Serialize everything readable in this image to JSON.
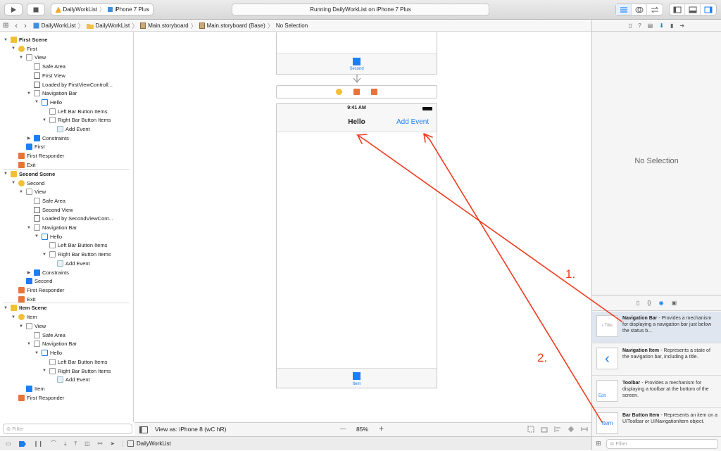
{
  "toolbar": {
    "scheme_name": "DailyWorkList",
    "device": "iPhone 7 Plus",
    "status_text": "Running DailyWorkList on iPhone 7 Plus"
  },
  "jumpbar": {
    "items": [
      "DailyWorkList",
      "DailyWorkList",
      "Main.storyboard",
      "Main.storyboard (Base)",
      "No Selection"
    ]
  },
  "outline": {
    "rows": [
      {
        "label": "First Scene",
        "level": 0,
        "kind": "scene",
        "tri": "▼"
      },
      {
        "label": "First",
        "level": 1,
        "kind": "vc",
        "tri": "▼"
      },
      {
        "label": "View",
        "level": 2,
        "kind": "view",
        "tri": "▼"
      },
      {
        "label": "Safe Area",
        "level": 3,
        "kind": "guide",
        "tri": ""
      },
      {
        "label": "First View",
        "level": 3,
        "kind": "label",
        "tri": ""
      },
      {
        "label": "Loaded by FirstViewControll...",
        "level": 3,
        "kind": "label",
        "tri": ""
      },
      {
        "label": "Navigation Bar",
        "level": 3,
        "kind": "view",
        "tri": "▼"
      },
      {
        "label": "Hello",
        "level": 4,
        "kind": "navitem",
        "tri": "▼"
      },
      {
        "label": "Left Bar Button Items",
        "level": 5,
        "kind": "view",
        "tri": ""
      },
      {
        "label": "Right Bar Button Items",
        "level": 5,
        "kind": "view",
        "tri": "▼"
      },
      {
        "label": "Add Event",
        "level": 6,
        "kind": "barbutton",
        "tri": ""
      },
      {
        "label": "Constraints",
        "level": 3,
        "kind": "constraints",
        "tri": "▶"
      },
      {
        "label": "First",
        "level": 2,
        "kind": "star",
        "tri": ""
      },
      {
        "label": "First Responder",
        "level": 1,
        "kind": "responder",
        "tri": ""
      },
      {
        "label": "Exit",
        "level": 1,
        "kind": "exit",
        "tri": ""
      },
      {
        "label": "Second Scene",
        "level": 0,
        "kind": "scene",
        "tri": "▼"
      },
      {
        "label": "Second",
        "level": 1,
        "kind": "vc",
        "tri": "▼"
      },
      {
        "label": "View",
        "level": 2,
        "kind": "view",
        "tri": "▼"
      },
      {
        "label": "Safe Area",
        "level": 3,
        "kind": "guide",
        "tri": ""
      },
      {
        "label": "Second View",
        "level": 3,
        "kind": "label",
        "tri": ""
      },
      {
        "label": "Loaded by SecondViewCont...",
        "level": 3,
        "kind": "label",
        "tri": ""
      },
      {
        "label": "Navigation Bar",
        "level": 3,
        "kind": "view",
        "tri": "▼"
      },
      {
        "label": "Hello",
        "level": 4,
        "kind": "navitem",
        "tri": "▼"
      },
      {
        "label": "Left Bar Button Items",
        "level": 5,
        "kind": "view",
        "tri": ""
      },
      {
        "label": "Right Bar Button Items",
        "level": 5,
        "kind": "view",
        "tri": "▼"
      },
      {
        "label": "Add Event",
        "level": 6,
        "kind": "barbutton",
        "tri": ""
      },
      {
        "label": "Constraints",
        "level": 3,
        "kind": "constraints",
        "tri": "▶"
      },
      {
        "label": "Second",
        "level": 2,
        "kind": "star",
        "tri": ""
      },
      {
        "label": "First Responder",
        "level": 1,
        "kind": "responder",
        "tri": ""
      },
      {
        "label": "Exit",
        "level": 1,
        "kind": "exit",
        "tri": ""
      },
      {
        "label": "Item Scene",
        "level": 0,
        "kind": "scene",
        "tri": "▼"
      },
      {
        "label": "Item",
        "level": 1,
        "kind": "vc",
        "tri": "▼"
      },
      {
        "label": "View",
        "level": 2,
        "kind": "view",
        "tri": "▼"
      },
      {
        "label": "Safe Area",
        "level": 3,
        "kind": "guide",
        "tri": ""
      },
      {
        "label": "Navigation Bar",
        "level": 3,
        "kind": "view",
        "tri": "▼"
      },
      {
        "label": "Hello",
        "level": 4,
        "kind": "navitem",
        "tri": "▼"
      },
      {
        "label": "Left Bar Button Items",
        "level": 5,
        "kind": "view",
        "tri": ""
      },
      {
        "label": "Right Bar Button Items",
        "level": 5,
        "kind": "view",
        "tri": "▼"
      },
      {
        "label": "Add Event",
        "level": 6,
        "kind": "barbutton",
        "tri": ""
      },
      {
        "label": "Item",
        "level": 2,
        "kind": "star",
        "tri": ""
      },
      {
        "label": "First Responder",
        "level": 1,
        "kind": "responder",
        "tri": ""
      }
    ],
    "filter_placeholder": "Filter"
  },
  "canvas": {
    "top_tab_label": "Second",
    "status_time": "9:41 AM",
    "nav_title": "Hello",
    "nav_right_button": "Add Event",
    "bottom_tab_label": "Item",
    "annotation_1": "1.",
    "annotation_2": "2."
  },
  "bottombar": {
    "view_as": "View as: iPhone 8 (wC hR)",
    "zoom": "85%",
    "minus": "—",
    "plus": "+"
  },
  "debugbar": {
    "target": "DailyWorkList"
  },
  "inspector": {
    "empty_text": "No Selection"
  },
  "library": {
    "items": [
      {
        "title": "Navigation Bar",
        "desc": " - Provides a mechanism for displaying a navigation bar just below the status b..."
      },
      {
        "title": "Navigation Item",
        "desc": " - Represents a state of the navigation bar, including a title."
      },
      {
        "title": "Toolbar",
        "desc": " - Provides a mechanism for displaying a toolbar at the bottom of the screen."
      },
      {
        "title": "Bar Button Item",
        "desc": " - Represents an item on a UIToolbar or UINavigationItem object."
      }
    ],
    "icon_texts": {
      "nav_bar_mini": "Title",
      "toolbar_mini": "Edit",
      "bar_button": "Item"
    },
    "filter_placeholder": "Filter"
  },
  "colors": {
    "accent": "#1a7ff5",
    "scene_yellow": "#f2c037",
    "responder_orange": "#e9733a",
    "annotation_red": "#f03a1e"
  }
}
